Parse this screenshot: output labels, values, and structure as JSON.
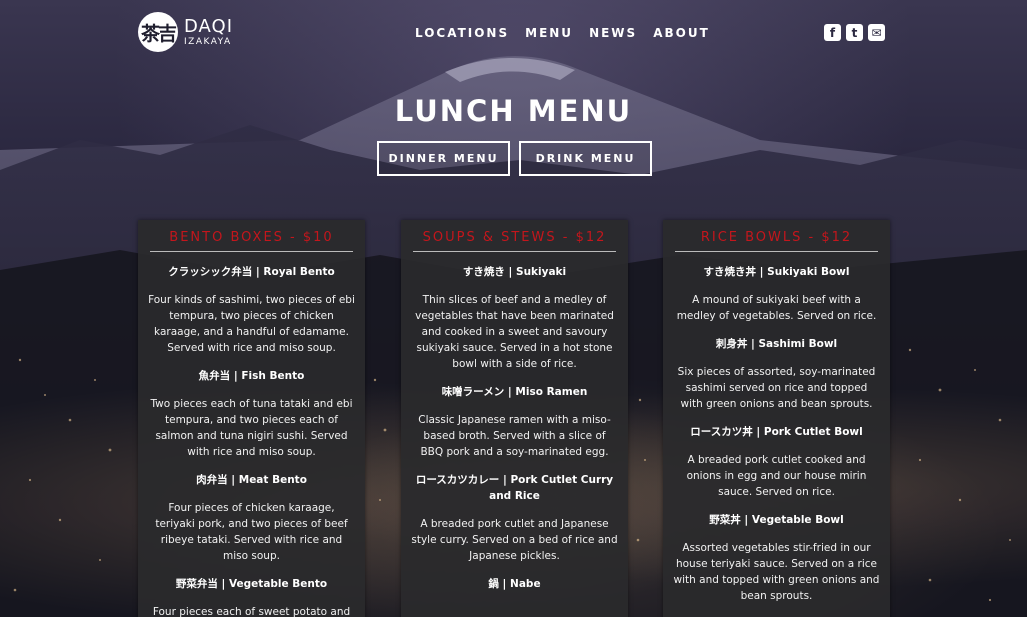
{
  "brand": {
    "logo_glyph": "茶吉",
    "name": "DAQI",
    "subtitle": "IZAKAYA"
  },
  "nav": {
    "items": [
      "LOCATIONS",
      "MENU",
      "NEWS",
      "ABOUT"
    ]
  },
  "social": {
    "facebook": "f",
    "twitter": "t",
    "email": "✉"
  },
  "hero": {
    "title": "LUNCH MENU",
    "buttons": [
      "DINNER MENU",
      "DRINK MENU"
    ]
  },
  "menu": {
    "sections": [
      {
        "title": "BENTO BOXES - $10",
        "items": [
          {
            "name": "クラッシック弁当 | Royal Bento",
            "desc": "Four kinds of sashimi, two pieces of ebi tempura, two pieces of chicken karaage, and a handful of edamame. Served with rice and miso soup."
          },
          {
            "name": "魚弁当 | Fish Bento",
            "desc": "Two pieces each of tuna tataki and ebi tempura, and two pieces each of salmon and tuna nigiri sushi. Served with rice and miso soup."
          },
          {
            "name": "肉弁当 | Meat Bento",
            "desc": "Four pieces of chicken karaage, teriyaki pork, and two pieces of beef ribeye tataki. Served with rice and miso soup."
          },
          {
            "name": "野菜弁当 | Vegetable Bento",
            "desc": "Four pieces each of sweet potato and"
          }
        ]
      },
      {
        "title": "SOUPS & STEWS - $12",
        "items": [
          {
            "name": "すき焼き | Sukiyaki",
            "desc": "Thin slices of beef and a medley of vegetables that have been marinated and cooked in a sweet and savoury sukiyaki sauce. Served in a hot stone bowl with a side of rice."
          },
          {
            "name": "味噌ラーメン | Miso Ramen",
            "desc": "Classic Japanese ramen with a miso-based broth. Served with a slice of BBQ pork and a soy-marinated egg."
          },
          {
            "name": "ロースカツカレー | Pork Cutlet Curry and Rice",
            "desc": "A breaded pork cutlet and Japanese style curry. Served on a bed of rice and Japanese pickles."
          },
          {
            "name": "鍋 | Nabe",
            "desc": ""
          }
        ]
      },
      {
        "title": "RICE BOWLS - $12",
        "items": [
          {
            "name": "すき焼き丼 | Sukiyaki Bowl",
            "desc": "A mound of sukiyaki beef with a medley of vegetables. Served on rice."
          },
          {
            "name": "刺身丼 | Sashimi Bowl",
            "desc": "Six pieces of assorted, soy-marinated sashimi served on rice and topped with green onions and bean sprouts."
          },
          {
            "name": "ロースカツ丼 | Pork Cutlet Bowl",
            "desc": "A breaded pork cutlet cooked and onions in egg and our house mirin sauce. Served on rice."
          },
          {
            "name": "野菜丼 | Vegetable Bowl",
            "desc": "Assorted vegetables stir-fried in our house teriyaki sauce. Served on a rice with and topped with green onions and bean sprouts."
          }
        ]
      }
    ]
  },
  "colors": {
    "accent_red": "#c4161c",
    "card_bg": "#2a2a2c"
  }
}
